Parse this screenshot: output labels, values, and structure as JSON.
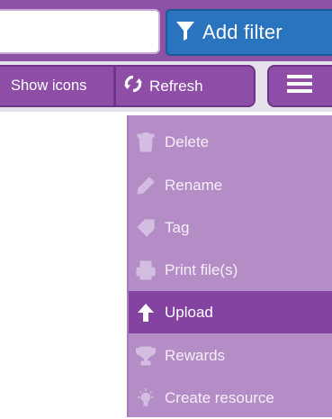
{
  "search": {
    "value": "",
    "placeholder": ""
  },
  "filter": {
    "add_label": "Add filter"
  },
  "toolbar": {
    "show_icons_label": "Show icons",
    "refresh_label": "Refresh"
  },
  "menu": {
    "items": [
      {
        "label": "Delete",
        "icon": "trash-icon"
      },
      {
        "label": "Rename",
        "icon": "pencil-icon"
      },
      {
        "label": "Tag",
        "icon": "tag-icon"
      },
      {
        "label": "Print file(s)",
        "icon": "printer-icon"
      },
      {
        "label": "Upload",
        "icon": "arrow-up-icon",
        "active": true
      },
      {
        "label": "Rewards",
        "icon": "trophy-icon"
      },
      {
        "label": "Create resource",
        "icon": "lightbulb-icon"
      }
    ]
  },
  "colors": {
    "header_purple": "#8b52a6",
    "button_purple": "#8e4ea8",
    "filter_blue": "#2a73be",
    "menu_bg": "#b48dc6",
    "menu_active": "#8443a1"
  }
}
